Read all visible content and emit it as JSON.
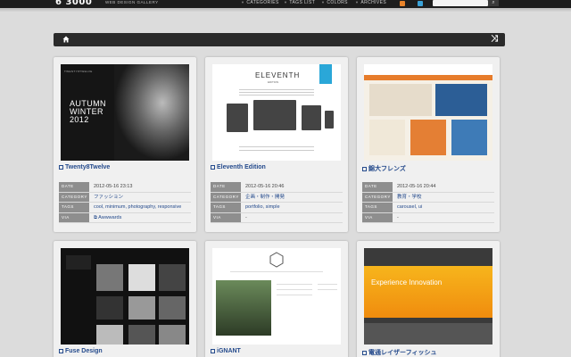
{
  "header": {
    "logo": "6 3000",
    "logo_sub": "WEB DESIGN GALLERY",
    "nav": [
      "CATEGORIES",
      "TAGS LIST",
      "COLORS",
      "ARCHIVES"
    ],
    "search_placeholder": ""
  },
  "toolbar": {
    "home_icon": "home-icon",
    "shuffle_icon": "shuffle-icon"
  },
  "labels": {
    "date": "DATE",
    "category": "CATEGORY",
    "tags": "TAGS",
    "via": "VIA"
  },
  "cards": [
    {
      "title": "Twenty8Twelve",
      "thumb_text": "AUTUMN\nWINTER\n2012",
      "date": "2012-05-16 23:13",
      "category": "ファッション",
      "tags": "cool, minimum, photography, responsive",
      "via": "Awwwards"
    },
    {
      "title": "Eleventh Edition",
      "thumb_text": "ELEVENTH",
      "date": "2012-05-16 20:46",
      "category": "企画・制作・開発",
      "tags": "portfolio, simple",
      "via": "-"
    },
    {
      "title": "錦大フレンズ",
      "date": "2012-05-16 20:44",
      "category": "教育・学校",
      "tags": "carousel, ui",
      "via": "-"
    },
    {
      "title": "Fuse Design"
    },
    {
      "title": "iGNANT"
    },
    {
      "title": "電通レイザーフィッシュ",
      "thumb_text": "Experience Innovation"
    }
  ]
}
